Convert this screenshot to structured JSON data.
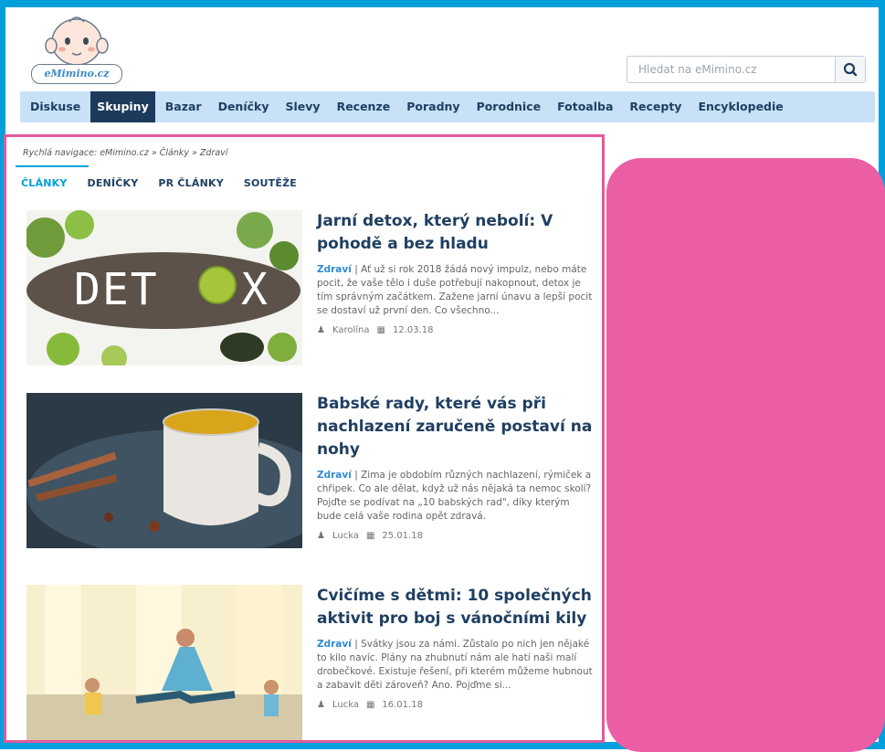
{
  "header": {
    "logo_text": "eMimino.cz",
    "search_placeholder": "Hledat na eMimino.cz"
  },
  "nav": {
    "items": [
      "Diskuse",
      "Skupiny",
      "Bazar",
      "Deníčky",
      "Slevy",
      "Recenze",
      "Poradny",
      "Porodnice",
      "Fotoalba",
      "Recepty",
      "Encyklopedie"
    ],
    "active": "Skupiny"
  },
  "breadcrumb": "Rychlá navigace: eMimino.cz » Články » Zdraví",
  "tabs": [
    "ČLÁNKY",
    "DENÍČKY",
    "PR ČLÁNKY",
    "SOUTĚŽE"
  ],
  "articles": [
    {
      "title": "Jarní detox, který nebolí: V pohodě a bez hladu",
      "category": "Zdraví",
      "excerpt": "Ať už si rok 2018 žádá nový impulz, nebo máte pocit, že vaše tělo i duše potřebují nakopnout, detox je tím správným začátkem. Zažene jarní únavu a lepší pocit se dostaví už první den. Co všechno...",
      "author": "Karolína",
      "date": "12.03.18",
      "thumb_word": "DETOX"
    },
    {
      "title": "Babské rady, které vás při nachlazení zaručeně postaví na nohy",
      "category": "Zdraví",
      "excerpt": "Zima je obdobím různých nachlazení, rýmiček a chřipek. Co ale dělat, když už nás nějaká ta nemoc skolí? Pojďte se podívat na „10 babských rad\", díky kterým bude celá vaše rodina opět zdravá.",
      "author": "Lucka",
      "date": "25.01.18"
    },
    {
      "title": "Cvičíme s dětmi: 10 společných aktivit pro boj s vánočními kily",
      "category": "Zdraví",
      "excerpt": "Svátky jsou za námi. Zůstalo po nich jen nějaké to kilo navíc. Plány na zhubnutí nám ale hatí naši malí drobečkové. Existuje řešení, při kterém můžeme hubnout a zabavit děti zároveň? Ano. Pojďme si...",
      "author": "Lucka",
      "date": "16.01.18"
    }
  ],
  "colors": {
    "frame": "#00a0dc",
    "nav_bg": "#c8e1f7",
    "nav_active": "#1d3a5c",
    "accent_pink": "#ec5ea3",
    "title": "#1f3f62",
    "category": "#2f8ad1"
  }
}
